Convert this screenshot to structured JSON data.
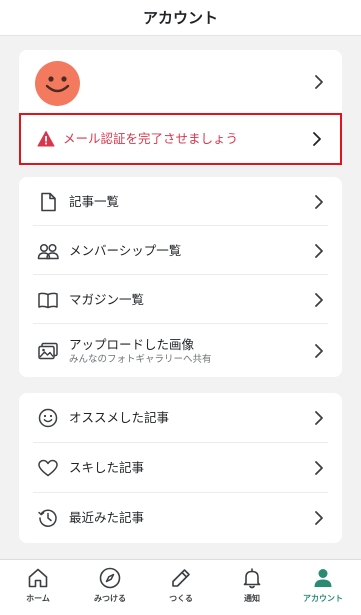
{
  "header": {
    "title": "アカウント"
  },
  "profile": {
    "alert_label": "メール認証を完了させましょう"
  },
  "menu_primary": [
    {
      "label": "記事一覧"
    },
    {
      "label": "メンバーシップ一覧"
    },
    {
      "label": "マガジン一覧"
    },
    {
      "label": "アップロードした画像",
      "sub": "みんなのフォトギャラリーへ共有"
    }
  ],
  "menu_secondary": [
    {
      "label": "オススメした記事"
    },
    {
      "label": "スキした記事"
    },
    {
      "label": "最近みた記事"
    }
  ],
  "tabbar": [
    {
      "label": "ホーム",
      "icon": "home-icon"
    },
    {
      "label": "みつける",
      "icon": "compass-icon"
    },
    {
      "label": "つくる",
      "icon": "pencil-icon"
    },
    {
      "label": "通知",
      "icon": "bell-icon"
    },
    {
      "label": "アカウント",
      "icon": "person-icon",
      "active": true
    }
  ],
  "colors": {
    "accent": "#2a8b73",
    "alert": "#d9354b",
    "highlight_border": "#e0141c",
    "avatar": "#f37a5e"
  }
}
